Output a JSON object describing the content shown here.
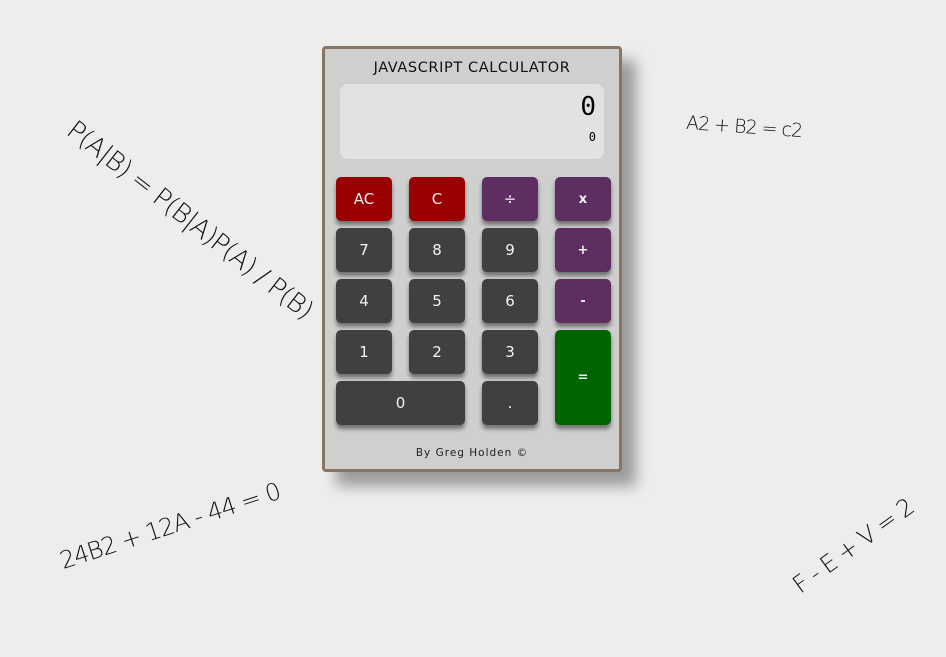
{
  "formulas": {
    "f1": "P(A|B) = P(B|A)P(A) / P(B)",
    "f2": "A2 + B2 = c2",
    "f3": "24B2 + 12A - 44 = 0",
    "f4": "F - E + V = 2"
  },
  "calculator": {
    "title": "JAVASCRIPT CALCULATOR",
    "display": {
      "main": "0",
      "formula": "0"
    },
    "buttons": {
      "ac": "AC",
      "c": "C",
      "divide": "÷",
      "multiply": "x",
      "seven": "7",
      "eight": "8",
      "nine": "9",
      "add": "+",
      "four": "4",
      "five": "5",
      "six": "6",
      "subtract": "-",
      "one": "1",
      "two": "2",
      "three": "3",
      "equals": "=",
      "zero": "0",
      "decimal": "."
    },
    "footer": "By Greg Holden ©"
  },
  "colors": {
    "clear": "#990000",
    "operator": "#5e2d62",
    "number": "#404040",
    "equals": "#006400",
    "frame": "#8a7462"
  }
}
